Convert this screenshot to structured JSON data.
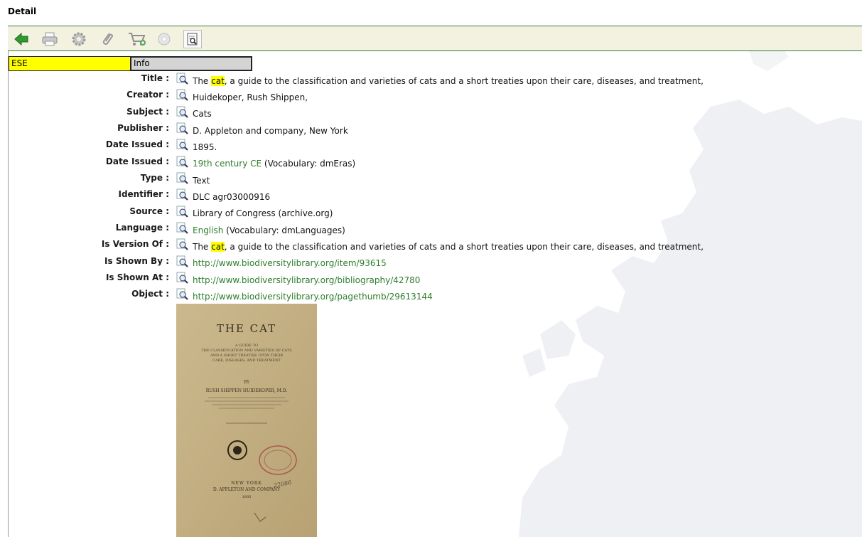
{
  "page": {
    "heading": "Detail"
  },
  "toolbar": {
    "buttons": [
      {
        "name": "back-button",
        "icon": "green-back-arrow-icon",
        "enabled": true
      },
      {
        "name": "print-button",
        "icon": "printer-icon",
        "enabled": false
      },
      {
        "name": "settings-button",
        "icon": "gear-icon",
        "enabled": false
      },
      {
        "name": "attach-button",
        "icon": "paperclip-icon",
        "enabled": false
      },
      {
        "name": "add-to-cart-button",
        "icon": "shopping-cart-add-icon",
        "enabled": false
      },
      {
        "name": "disc-button",
        "icon": "disc-icon",
        "enabled": false
      },
      {
        "name": "view-detail-button",
        "icon": "document-zoom-icon",
        "enabled": true
      }
    ]
  },
  "tabs": {
    "ese": "ESE",
    "info": "Info"
  },
  "colors": {
    "highlight": "#ffff00",
    "link": "#2e7d2e",
    "toolbar_bg": "#f3f1df",
    "rule": "#3c7a3c"
  },
  "fields": {
    "title": {
      "label": "Title :",
      "pre": "The ",
      "hl": "cat",
      "post": ", a guide to the classification and varieties of cats and a short treaties upon their care, diseases, and treatment,"
    },
    "creator": {
      "label": "Creator :",
      "value": "Huidekoper, Rush Shippen,"
    },
    "subject": {
      "label": "Subject :",
      "value": "Cats"
    },
    "publisher": {
      "label": "Publisher :",
      "value": "D. Appleton and company, New York"
    },
    "date_issued_1": {
      "label": "Date Issued :",
      "value": "1895."
    },
    "date_issued_2": {
      "label": "Date Issued :",
      "link": "19th century CE",
      "suffix": " (Vocabulary: dmEras)"
    },
    "type": {
      "label": "Type :",
      "value": "Text"
    },
    "identifier": {
      "label": "Identifier :",
      "value": "DLC agr03000916"
    },
    "source": {
      "label": "Source :",
      "value": "Library of Congress (archive.org)"
    },
    "language": {
      "label": "Language :",
      "link": "English",
      "suffix": " (Vocabulary: dmLanguages)"
    },
    "is_version_of": {
      "label": "Is Version Of :",
      "pre": "The ",
      "hl": "cat",
      "post": ", a guide to the classification and varieties of cats and a short treaties upon their care, diseases, and treatment,"
    },
    "is_shown_by": {
      "label": "Is Shown By :",
      "link": "http://www.biodiversitylibrary.org/item/93615"
    },
    "is_shown_at": {
      "label": "Is Shown At :",
      "link": "http://www.biodiversitylibrary.org/bibliography/42780"
    },
    "object": {
      "label": "Object :",
      "link": "http://www.biodiversitylibrary.org/pagethumb/29613144"
    }
  },
  "thumbnail": {
    "heading": "THE CAT",
    "subtitle_1": "A GUIDE TO",
    "subtitle_2": "THE CLASSIFICATION AND VARIETIES OF CATS",
    "subtitle_3": "AND A SHORT TREATISE UPON THEIR",
    "subtitle_4": "CARE, DISEASES, AND TREATMENT",
    "by": "BY",
    "author": "RUSH SHIPPEN HUIDEKOPER, M.D.",
    "city": "NEW YORK",
    "publisher": "D. APPLETON AND COMPANY",
    "year": "1895"
  }
}
